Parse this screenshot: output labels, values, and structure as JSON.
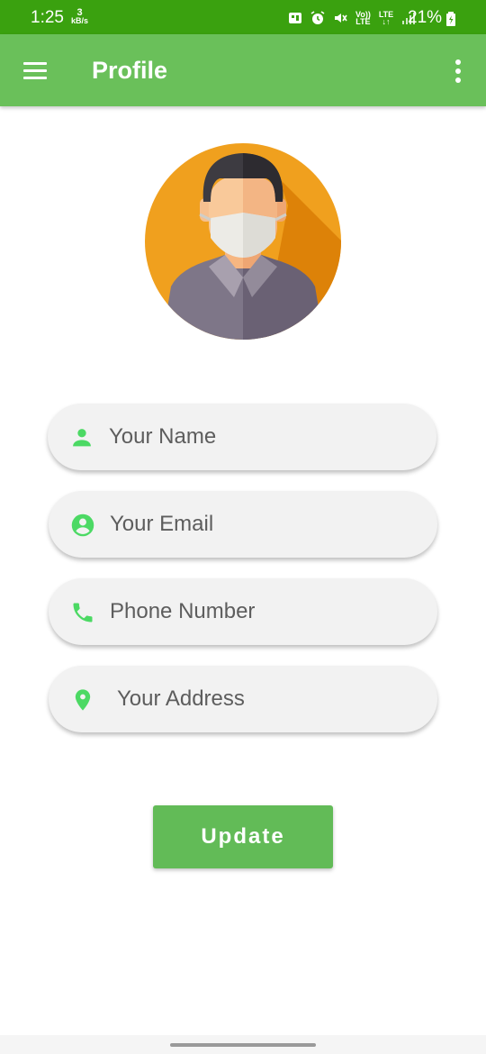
{
  "status_bar": {
    "time": "1:25",
    "speed_value": "3",
    "speed_unit": "kB/s",
    "volte": "Vo))",
    "lte_label": "LTE",
    "lte2_label": "LTE",
    "battery_percent": "21%",
    "icons": [
      "wallet-icon",
      "alarm-icon",
      "mute-icon",
      "volte-icon",
      "lte-icon",
      "signal-icon",
      "battery-charging-icon"
    ]
  },
  "app_bar": {
    "title": "Profile",
    "menu_icon": "hamburger-menu-icon",
    "overflow_icon": "more-vert-icon",
    "background_color": "#6ac05a"
  },
  "avatar": {
    "icon": "masked-man-avatar-icon",
    "background_color": "#f0a01e"
  },
  "form": {
    "name_placeholder": "Your Name",
    "email_placeholder": "Your Email",
    "phone_placeholder": "Phone Number",
    "address_placeholder": "Your Address",
    "icon_color": "#4cd964"
  },
  "update_button": {
    "label": "Update",
    "color": "#62bb57"
  }
}
